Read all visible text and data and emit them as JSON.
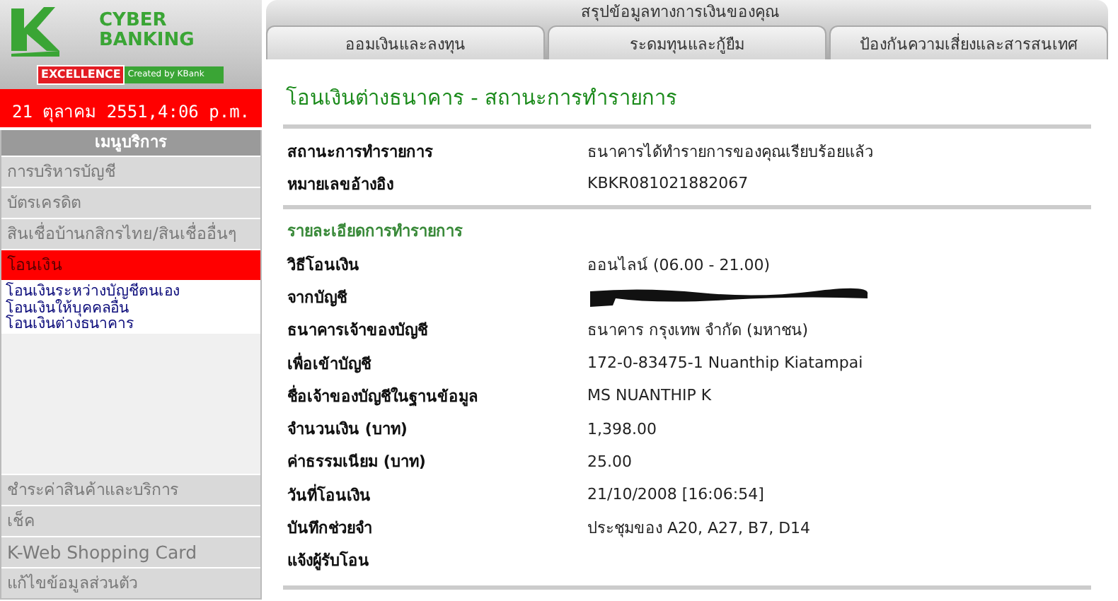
{
  "logo": {
    "line1": "CYBER",
    "line2": "BANKING",
    "badge": "EXCELLENCE",
    "tagline": "Created by KBank"
  },
  "date": "21 ตุลาคม 2551,4:06 p.m.",
  "menu": {
    "title": "เมนูบริการ",
    "items": [
      {
        "label": "การบริหารบัญชี",
        "selected": false
      },
      {
        "label": "บัตรเครดิต",
        "selected": false
      },
      {
        "label": "สินเชื่อบ้านกสิกรไทย/สินเชื่ออื่นๆ",
        "selected": false
      },
      {
        "label": "โอนเงิน",
        "selected": true,
        "children": [
          {
            "label": "โอนเงินระหว่างบัญชีตนเอง"
          },
          {
            "label": "โอนเงินให้บุคคลอื่น"
          },
          {
            "label": "โอนเงินต่างธนาคาร"
          }
        ]
      }
    ],
    "bottom_items": [
      {
        "label": "ชำระค่าสินค้าและบริการ",
        "selected": false
      },
      {
        "label": "เช็ค",
        "selected": false
      },
      {
        "label": "K-Web Shopping Card",
        "selected": false
      },
      {
        "label": "แก้ไขข้อมูลส่วนตัว",
        "selected": false
      }
    ]
  },
  "nav": {
    "summary_tab": "สรุปข้อมูลทางการเงินของคุณ",
    "tabs": [
      "ออมเงินและลงทุน",
      "ระดมทุนและกู้ยืม",
      "ป้องกันความเสี่ยงและสารสนเทศ"
    ]
  },
  "page_title": "โอนเงินต่างธนาคาร - สถานะการทำรายการ",
  "status_rows": [
    {
      "label": "สถานะการทำรายการ",
      "value": "ธนาคารได้ทำรายการของคุณเรียบร้อยแล้ว"
    },
    {
      "label": "หมายเลขอ้างอิง",
      "value": "KBKR081021882067"
    }
  ],
  "details_title": "รายละเอียดการทำรายการ",
  "detail_rows": [
    {
      "kind": "text",
      "label": "วิธีโอนเงิน",
      "value": "ออนไลน์ (06.00 - 21.00)"
    },
    {
      "kind": "redacted",
      "label": "จากบัญชี"
    },
    {
      "kind": "text",
      "label": "ธนาคารเจ้าของบัญชี",
      "value": "ธนาคาร กรุงเทพ จำกัด (มหาชน)"
    },
    {
      "kind": "text",
      "label": "เพื่อเข้าบัญชี",
      "value": "172-0-83475-1 Nuanthip Kiatampai"
    },
    {
      "kind": "text",
      "label": "ชื่อเจ้าของบัญชีในฐานข้อมูล",
      "value": "MS NUANTHIP K"
    },
    {
      "kind": "text",
      "label": "จำนวนเงิน (บาท)",
      "value": "1,398.00"
    },
    {
      "kind": "text",
      "label": "ค่าธรรมเนียม (บาท)",
      "value": "25.00"
    },
    {
      "kind": "text",
      "label": "วันที่โอนเงิน",
      "value": "21/10/2008 [16:06:54]"
    },
    {
      "kind": "text",
      "label": "บันทึกช่วยจำ",
      "value": "ประชุมของ A20, A27, B7, D14"
    },
    {
      "kind": "label",
      "label": "แจ้งผู้รับโอน"
    }
  ]
}
